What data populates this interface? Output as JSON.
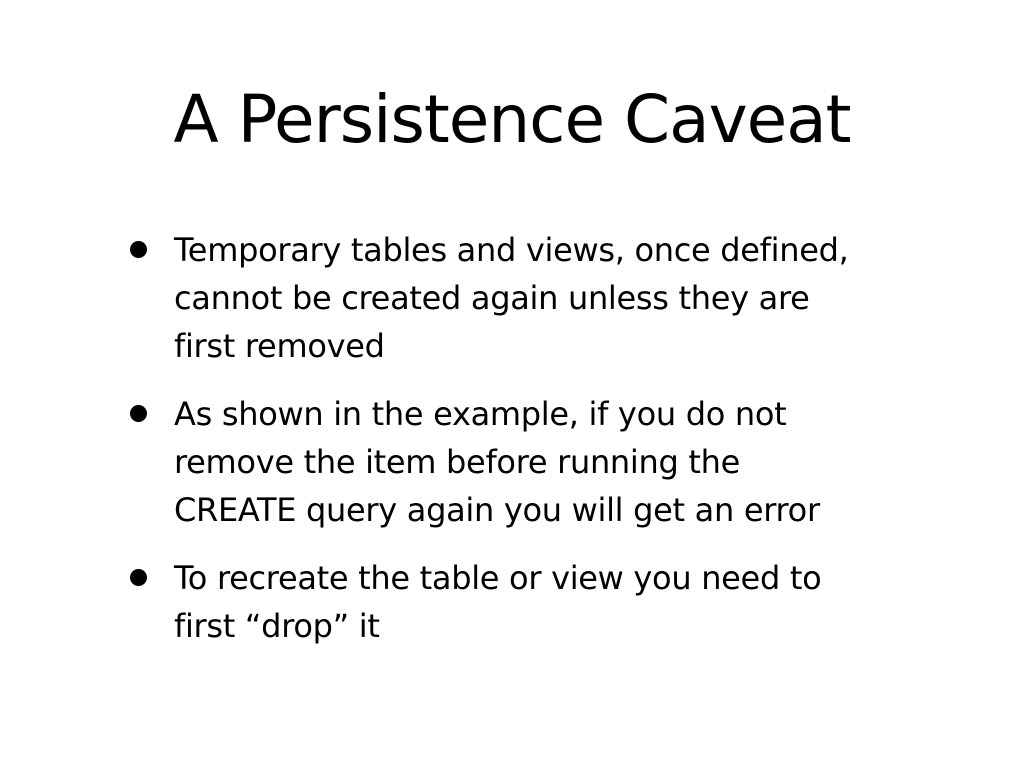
{
  "slide": {
    "title": "A Persistence Caveat",
    "bullets": [
      {
        "lines": [
          "Temporary tables and views, once defined,",
          "cannot be created again unless they are",
          "first removed"
        ]
      },
      {
        "lines": [
          "As shown in the example, if you do not",
          "remove the item before running the",
          "CREATE query again you will get an error"
        ]
      },
      {
        "lines": [
          "To recreate the table or view you need to",
          "first “drop” it"
        ]
      }
    ]
  },
  "colors": {
    "background": "#ffffff",
    "text": "#000000"
  },
  "icons": {
    "bullet": "bullet-dot-icon"
  }
}
